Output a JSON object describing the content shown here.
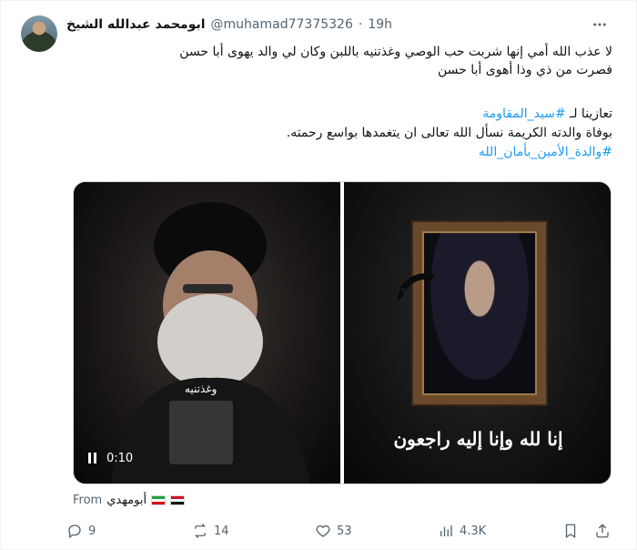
{
  "tweet": {
    "author_name": "ابومحمد عبدالله الشيخ",
    "handle": "@muhamad77375326",
    "separator": "·",
    "time": "19h",
    "text_lines_1": [
      "لا عذب الله أمي إنها شربت حب الوصي وغذتنيه باللبن وكان لي والد يهوى أبا حسن",
      "فصرت من ذي وذا أهوى أبا حسن"
    ],
    "line2_prefix": "تعازينا لـ ",
    "line2_hashtag": "#سيد_المقاومة",
    "line3": "بوفاة والدته الكريمة نسأل الله تعالى ان يتغمدها بواسع رحمته.",
    "line4_hashtag": "#والدة_الأمين_بأمان_الله"
  },
  "media": {
    "video_overlay_text": "وغذتنيه",
    "video_time": "0:10",
    "calligraphy_text": "إنا لله وإنا إليه راجعون"
  },
  "source": {
    "from_label": "From",
    "name": "أبومهدي"
  },
  "actions": {
    "replies": "9",
    "reposts": "14",
    "likes": "53",
    "views": "4.3K"
  },
  "colors": {
    "accent": "#1d9bf0",
    "text": "#0f1419",
    "muted": "#536471"
  }
}
